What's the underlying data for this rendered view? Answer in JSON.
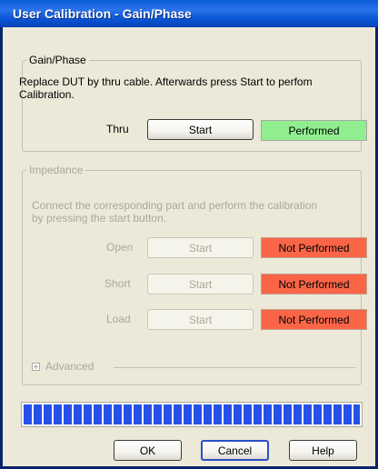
{
  "window": {
    "title": "User Calibration - Gain/Phase"
  },
  "gain_phase": {
    "legend": "Gain/Phase",
    "instruction_line1": "Replace DUT by thru cable. Afterwards press Start to perfom",
    "instruction_line2": "Calibration.",
    "thru": {
      "label": "Thru",
      "button": "Start",
      "status": "Performed",
      "status_color": "#90ee90"
    }
  },
  "impedance": {
    "legend": "Impedance",
    "instruction_line1": "Connect the corresponding part and perform the calibration",
    "instruction_line2": "by pressing the start button.",
    "rows": [
      {
        "label": "Open",
        "button": "Start",
        "status": "Not Performed",
        "status_color": "#fa6548"
      },
      {
        "label": "Short",
        "button": "Start",
        "status": "Not Performed",
        "status_color": "#fa6548"
      },
      {
        "label": "Load",
        "button": "Start",
        "status": "Not Performed",
        "status_color": "#fa6548"
      }
    ],
    "advanced_label": "Advanced"
  },
  "progress": {
    "fraction": 1.0
  },
  "buttons": {
    "ok": "OK",
    "cancel": "Cancel",
    "help": "Help"
  }
}
